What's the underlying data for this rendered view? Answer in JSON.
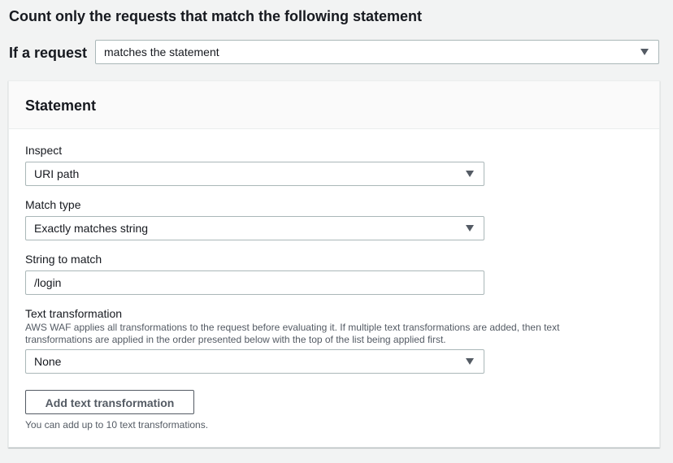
{
  "heading": "Count only the requests that match the following statement",
  "condition": {
    "label": "If a request",
    "value": "matches the statement"
  },
  "statement": {
    "title": "Statement",
    "inspect": {
      "label": "Inspect",
      "value": "URI path"
    },
    "match_type": {
      "label": "Match type",
      "value": "Exactly matches string"
    },
    "string_to_match": {
      "label": "String to match",
      "value": "/login"
    },
    "text_transformation": {
      "label": "Text transformation",
      "description": "AWS WAF applies all transformations to the request before evaluating it. If multiple text transformations are added, then text transformations are applied in the order presented below with the top of the list being applied first.",
      "value": "None",
      "add_button_label": "Add text transformation",
      "hint": "You can add up to 10 text transformations."
    }
  },
  "icons": {
    "dropdown": "caret-down-icon"
  },
  "colors": {
    "border": "#aab7b8",
    "text": "#16191f",
    "secondary_text": "#545b64",
    "page_bg": "#f2f3f3"
  }
}
